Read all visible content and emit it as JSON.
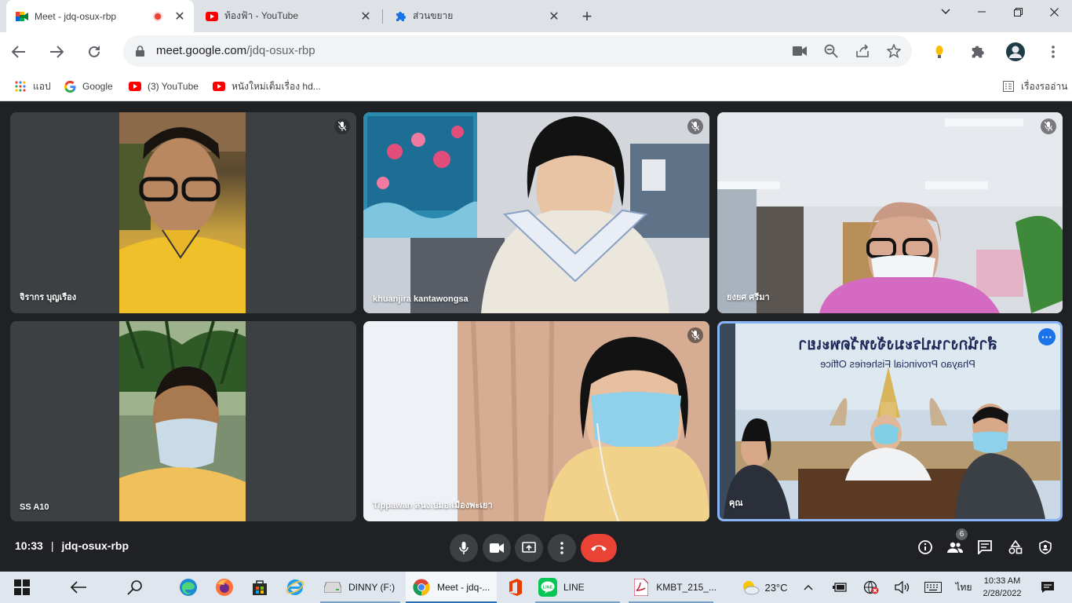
{
  "tabs": [
    {
      "title": "Meet - jdq-osux-rbp",
      "active": true,
      "recording": true
    },
    {
      "title": "ท้องฟ้า - YouTube",
      "active": false
    },
    {
      "title": "ส่วนขยาย",
      "active": false
    }
  ],
  "address_bar": {
    "host": "meet.google.com",
    "path": "/jdq-osux-rbp"
  },
  "bookmarks": [
    {
      "label": "แอป",
      "icon": "apps-grid-icon"
    },
    {
      "label": "Google",
      "icon": "google-icon"
    },
    {
      "label": "(3) YouTube",
      "icon": "youtube-icon"
    },
    {
      "label": "หนังใหม่เต็มเรื่อง hd...",
      "icon": "youtube-icon"
    }
  ],
  "reading_list": "เรื่องรออ่าน",
  "participants": [
    {
      "name": "จิรากร บุญเรือง",
      "muted": true
    },
    {
      "name": "khuanjira kantawongsa",
      "muted": true
    },
    {
      "name": "ยงยศ ศรีมา",
      "muted": true
    },
    {
      "name": "SS A10",
      "muted": false
    },
    {
      "name": "Tippawan สนง.ปมอ.เมืองพะเยา",
      "muted": true
    },
    {
      "name": "คุณ",
      "muted": false,
      "self": true
    }
  ],
  "self_background": {
    "sign_thai": "สำนักงานประมงจังหวัดพะเยา",
    "sign_english": "Phayao Provincial Fisheries Office"
  },
  "meeting": {
    "time": "10:33",
    "code": "jdq-osux-rbp",
    "people_count": "6"
  },
  "taskbar": {
    "apps": [
      {
        "label": "DINNY (F:)",
        "icon": "drive-icon"
      },
      {
        "label": "Meet - jdq-...",
        "icon": "chrome-icon",
        "active": true
      },
      {
        "label": "LINE",
        "icon": "line-icon"
      },
      {
        "label": "KMBT_215_...",
        "icon": "pdf-icon"
      }
    ],
    "weather": "23°C",
    "language": "ไทย",
    "time": "10:33 AM",
    "date": "2/28/2022"
  },
  "colors": {
    "accent": "#1a73e8",
    "end_call": "#ea4335",
    "self_border": "#8ab4f8",
    "background": "#202124"
  }
}
